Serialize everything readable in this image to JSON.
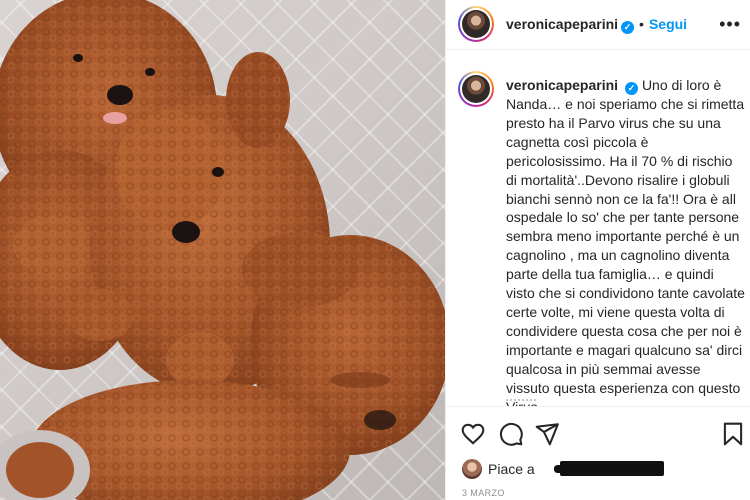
{
  "post": {
    "image_alt": "",
    "author": {
      "username": "veronicapeparini",
      "verified_icon": "verified-badge-icon",
      "follow_label": "Segui",
      "separator": "•"
    },
    "caption": {
      "username": "veronicapeparini",
      "text": "Uno di loro è Nanda… e noi speriamo che si rimetta presto ha il Parvo virus che su una cagnetta così piccola è pericolosissimo. Ha il 70 % di rischio di mortalità'..Devono risalire i globuli bianchi sennò non ce la fa'!! Ora è all ospedale lo so' che per tante persone sembra meno importante perché è un cagnolino , ma un cagnolino diventa parte della tua famiglia… e quindi visto che si condividono tante cavolate certe volte, mi viene questa volta di condividere questa cosa che per noi è importante e magari qualcuno sa' dirci qualcosa in più semmai avesse vissuto questa esperienza con questo Virus…",
      "emojis": "🤞❤️"
    },
    "actions": {
      "like_icon": "heart-icon",
      "comment_icon": "comment-icon",
      "share_icon": "send-icon",
      "save_icon": "bookmark-icon"
    },
    "likes": {
      "prefix": "Piace a"
    },
    "date": "3 MARZO"
  },
  "colors": {
    "accent": "#0095f6",
    "text": "#262626",
    "muted": "#8e8e8e",
    "fur": "#a3532a"
  }
}
